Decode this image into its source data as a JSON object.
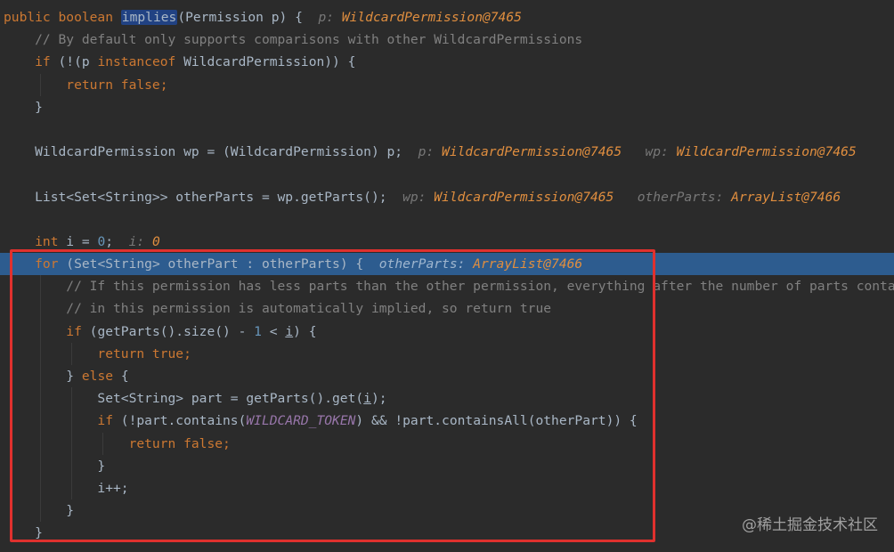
{
  "code_lines": [
    {
      "highlight": false,
      "tokens": [
        {
          "t": "public boolean ",
          "c": "kw"
        },
        {
          "t": "implies",
          "c": "plain sel"
        },
        {
          "t": "(Permission p) {  ",
          "c": "plain"
        },
        {
          "t": "p: ",
          "c": "hint"
        },
        {
          "t": "WildcardPermission@7465",
          "c": "hint-val"
        }
      ]
    },
    {
      "highlight": false,
      "tokens": [
        {
          "t": "    // By default only supports comparisons with other WildcardPermissions",
          "c": "cm"
        }
      ]
    },
    {
      "highlight": false,
      "tokens": [
        {
          "t": "    if ",
          "c": "kw"
        },
        {
          "t": "(!(p ",
          "c": "plain"
        },
        {
          "t": "instanceof ",
          "c": "kw"
        },
        {
          "t": "WildcardPermission)) {",
          "c": "plain"
        }
      ]
    },
    {
      "highlight": false,
      "tokens": [
        {
          "t": "        return false;",
          "c": "kw"
        }
      ]
    },
    {
      "highlight": false,
      "tokens": [
        {
          "t": "    }",
          "c": "plain"
        }
      ]
    },
    {
      "highlight": false,
      "tokens": []
    },
    {
      "highlight": false,
      "tokens": [
        {
          "t": "    WildcardPermission wp = (WildcardPermission) p;  ",
          "c": "plain"
        },
        {
          "t": "p: ",
          "c": "hint"
        },
        {
          "t": "WildcardPermission@7465",
          "c": "hint-val"
        },
        {
          "t": "   wp: ",
          "c": "hint"
        },
        {
          "t": "WildcardPermission@7465",
          "c": "hint-val"
        }
      ]
    },
    {
      "highlight": false,
      "tokens": []
    },
    {
      "highlight": false,
      "tokens": [
        {
          "t": "    List<Set<String>> otherParts = wp.getParts();  ",
          "c": "plain"
        },
        {
          "t": "wp: ",
          "c": "hint"
        },
        {
          "t": "WildcardPermission@7465",
          "c": "hint-val"
        },
        {
          "t": "   otherParts: ",
          "c": "hint"
        },
        {
          "t": "ArrayList@7466",
          "c": "hint-val"
        }
      ]
    },
    {
      "highlight": false,
      "tokens": []
    },
    {
      "highlight": false,
      "tokens": [
        {
          "t": "    int ",
          "c": "kw"
        },
        {
          "t": "i = ",
          "c": "plain"
        },
        {
          "t": "0",
          "c": "num"
        },
        {
          "t": ";  ",
          "c": "plain"
        },
        {
          "t": "i: ",
          "c": "hint"
        },
        {
          "t": "0",
          "c": "hint-val"
        }
      ]
    },
    {
      "highlight": true,
      "tokens": [
        {
          "t": "    for ",
          "c": "kw"
        },
        {
          "t": "(Set<String> otherPart : otherParts) {  ",
          "c": "plain"
        },
        {
          "t": "otherParts: ",
          "c": "hint"
        },
        {
          "t": "ArrayList@7466",
          "c": "hint-val"
        }
      ]
    },
    {
      "highlight": false,
      "tokens": [
        {
          "t": "        // If this permission has less parts than the other permission, everything after the number of parts contai",
          "c": "cm"
        }
      ]
    },
    {
      "highlight": false,
      "tokens": [
        {
          "t": "        // in this permission is automatically implied, so return true",
          "c": "cm"
        }
      ]
    },
    {
      "highlight": false,
      "tokens": [
        {
          "t": "        if ",
          "c": "kw"
        },
        {
          "t": "(getParts().size() - ",
          "c": "plain"
        },
        {
          "t": "1",
          "c": "num"
        },
        {
          "t": " < ",
          "c": "plain"
        },
        {
          "t": "i",
          "c": "plain ul"
        },
        {
          "t": ") {",
          "c": "plain"
        }
      ]
    },
    {
      "highlight": false,
      "tokens": [
        {
          "t": "            return true;",
          "c": "kw"
        }
      ]
    },
    {
      "highlight": false,
      "tokens": [
        {
          "t": "        } ",
          "c": "plain"
        },
        {
          "t": "else ",
          "c": "kw"
        },
        {
          "t": "{",
          "c": "plain"
        }
      ]
    },
    {
      "highlight": false,
      "tokens": [
        {
          "t": "            Set<String> part = getParts().get(",
          "c": "plain"
        },
        {
          "t": "i",
          "c": "plain ul"
        },
        {
          "t": ");",
          "c": "plain"
        }
      ]
    },
    {
      "highlight": false,
      "tokens": [
        {
          "t": "            if ",
          "c": "kw"
        },
        {
          "t": "(!part.contains(",
          "c": "plain"
        },
        {
          "t": "WILDCARD_TOKEN",
          "c": "const"
        },
        {
          "t": ") && !part.containsAll(otherPart)) {",
          "c": "plain"
        }
      ]
    },
    {
      "highlight": false,
      "tokens": [
        {
          "t": "                return false;",
          "c": "kw"
        }
      ]
    },
    {
      "highlight": false,
      "tokens": [
        {
          "t": "            }",
          "c": "plain"
        }
      ]
    },
    {
      "highlight": false,
      "tokens": [
        {
          "t": "            i++;",
          "c": "plain"
        }
      ]
    },
    {
      "highlight": false,
      "tokens": [
        {
          "t": "        }",
          "c": "plain"
        }
      ]
    },
    {
      "highlight": false,
      "tokens": [
        {
          "t": "    }",
          "c": "plain"
        }
      ]
    }
  ],
  "watermark": "@稀土掘金技术社区",
  "colors": {
    "background": "#2b2b2b",
    "keyword": "#cc7832",
    "comment": "#808080",
    "number": "#6897bb",
    "hint_value": "#e08e3f",
    "current_line": "#2d5c8f",
    "annotation_box": "#e0312e"
  }
}
